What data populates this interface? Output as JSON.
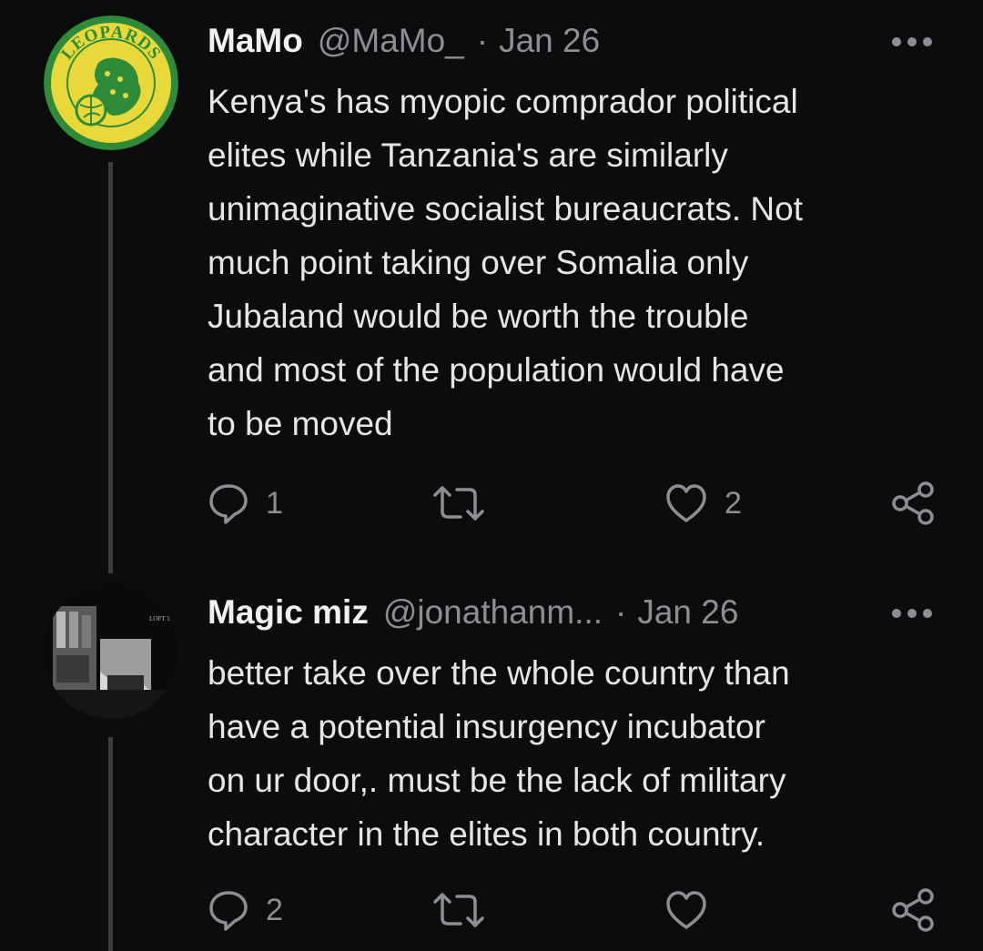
{
  "tweets": [
    {
      "author_name": "MaMo",
      "handle": "@MaMo_",
      "separator": "·",
      "date": "Jan 26",
      "text": "Kenya's has myopic comprador political\nelites while Tanzania's are similarly\nunimaginative socialist bureaucrats. Not\nmuch point taking over Somalia only\nJubaland would be worth the trouble\nand most of the population would have\nto be moved",
      "reply_count": "1",
      "retweet_count": "",
      "like_count": "2",
      "avatar": {
        "logo_text": "LEOPARDS",
        "ring_color": "#2e8b3a",
        "fill_color": "#e9d83a"
      }
    },
    {
      "author_name": "Magic miz",
      "handle": "@jonathanm...",
      "separator": "·",
      "date": "Jan 26",
      "text": "better take over the whole country than\nhave a potential insurgency incubator\non ur door,. must be the lack of military\ncharacter in the elites in both country.",
      "reply_count": "2",
      "retweet_count": "",
      "like_count": "",
      "avatar": {
        "logo_text": "LOFT TALK"
      }
    }
  ],
  "icons": {
    "reply": "speech-bubble-icon",
    "retweet": "retweet-icon",
    "like": "heart-icon",
    "share": "share-icon",
    "more": "more-horizontal-icon"
  },
  "colors": {
    "background": "#0c0c0c",
    "text": "#e6e6e6",
    "muted": "#8b8f95",
    "thread_line": "#3a3d41"
  }
}
